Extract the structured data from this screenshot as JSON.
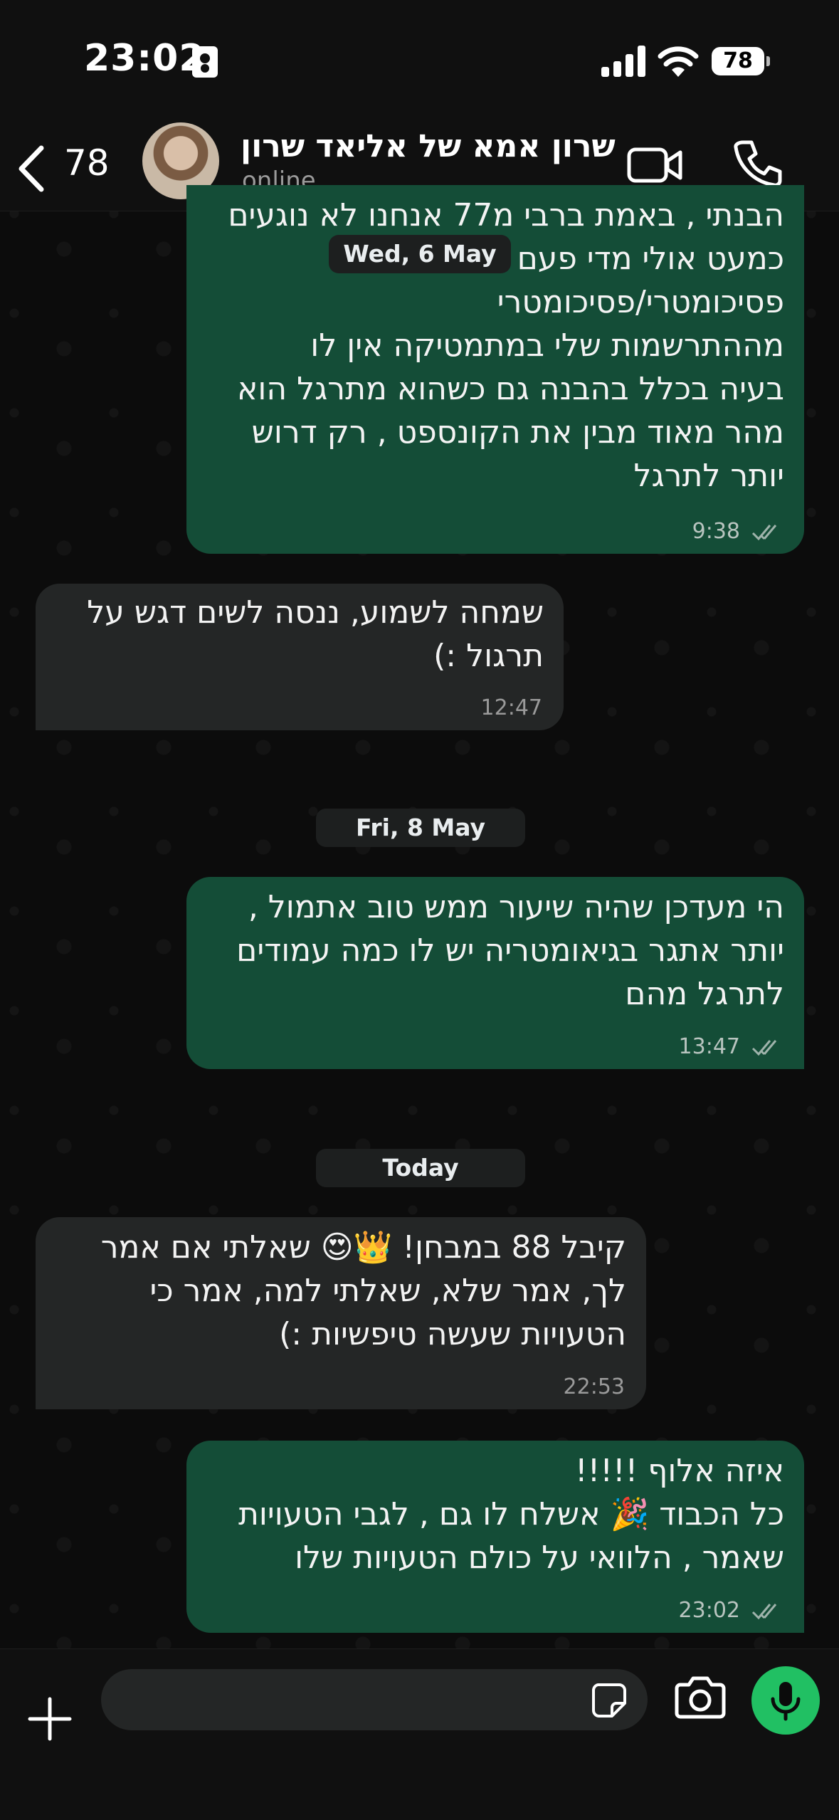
{
  "status_bar": {
    "time": "23:02",
    "battery": "78"
  },
  "header": {
    "back_count": "78",
    "contact_name": "שרון אמא של אליאד שרון",
    "contact_status": "online"
  },
  "messages": [
    {
      "direction": "out",
      "text": "הבנתי , באמת ברבי מ77 אנחנו לא נוגעים\nכמעט אולי מדי פעם בשאלת\nפסיכומטרי/פסיכומטרי\nמההתרשמות שלי במתמטיקה אין לו\nבעיה בכלל בהבנה גם כשהוא מתרגל הוא\nמהר מאוד מבין את הקונספט , רק דרוש\nיותר לתרגל",
      "time": "9:38"
    },
    {
      "direction": "in",
      "text": "שמחה לשמוע, ננסה לשים דגש על\nתרגול :)",
      "time": "12:47"
    },
    {
      "direction": "out",
      "text": "הי מעדכן שהיה שיעור ממש טוב אתמול ,\nיותר אתגר בגיאומטריה יש לו כמה עמודים\nלתרגל מהם",
      "time": "13:47"
    },
    {
      "direction": "in",
      "text": "קיבל 88 במבחן! 👑😍 שאלתי אם אמר\nלך, אמר שלא, שאלתי למה, אמר כי\nהטעויות שעשה טיפשיות :)",
      "time": "22:53"
    },
    {
      "direction": "out",
      "text": "איזה אלוף !!!!!\nכל הכבוד 🎉 אשלח לו גם , לגבי הטעויות\nשאמר , הלוואי על כולם הטעויות שלו",
      "time": "23:02"
    }
  ],
  "date_separators": [
    "Wed, 6 May",
    "Fri, 8 May",
    "Today"
  ],
  "colors": {
    "outgoing_bubble": "#144d37",
    "incoming_bubble": "#242626",
    "accent": "#21c063"
  },
  "icons": [
    "back-chevron",
    "video-camera",
    "phone",
    "plus",
    "sticker",
    "camera",
    "microphone"
  ]
}
